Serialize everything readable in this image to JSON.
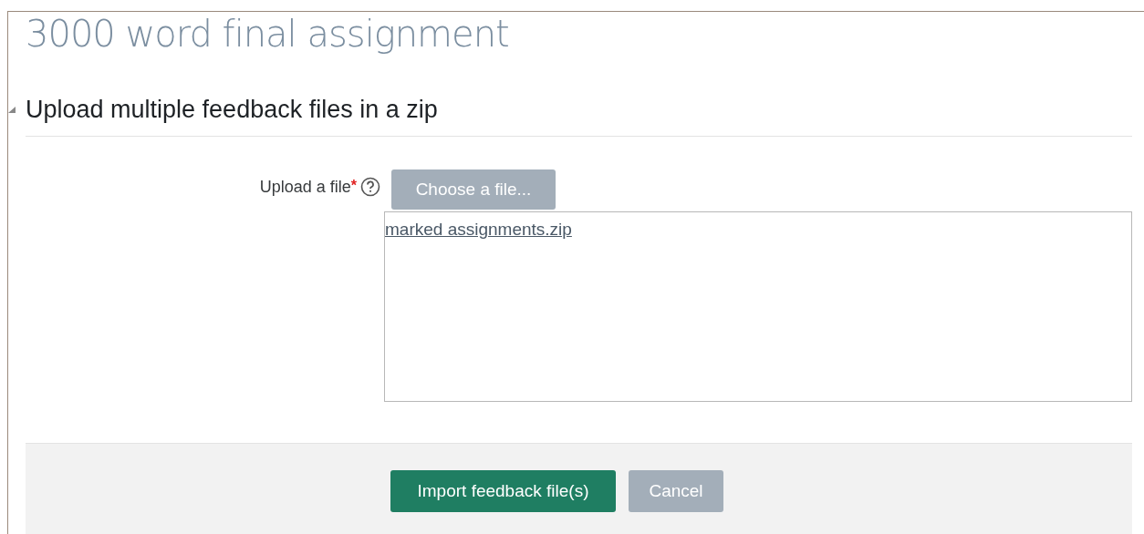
{
  "page_title": "3000 word final assignment",
  "section": {
    "title": "Upload multiple feedback files in a zip",
    "expanded": true
  },
  "field": {
    "label": "Upload a file",
    "required_mark": "*",
    "button": "Choose a file...",
    "files": [
      "marked assignments.zip"
    ]
  },
  "buttons": [
    {
      "label": "Import feedback file(s)",
      "kind": "primary"
    },
    {
      "label": "Cancel",
      "kind": "secondary"
    }
  ]
}
